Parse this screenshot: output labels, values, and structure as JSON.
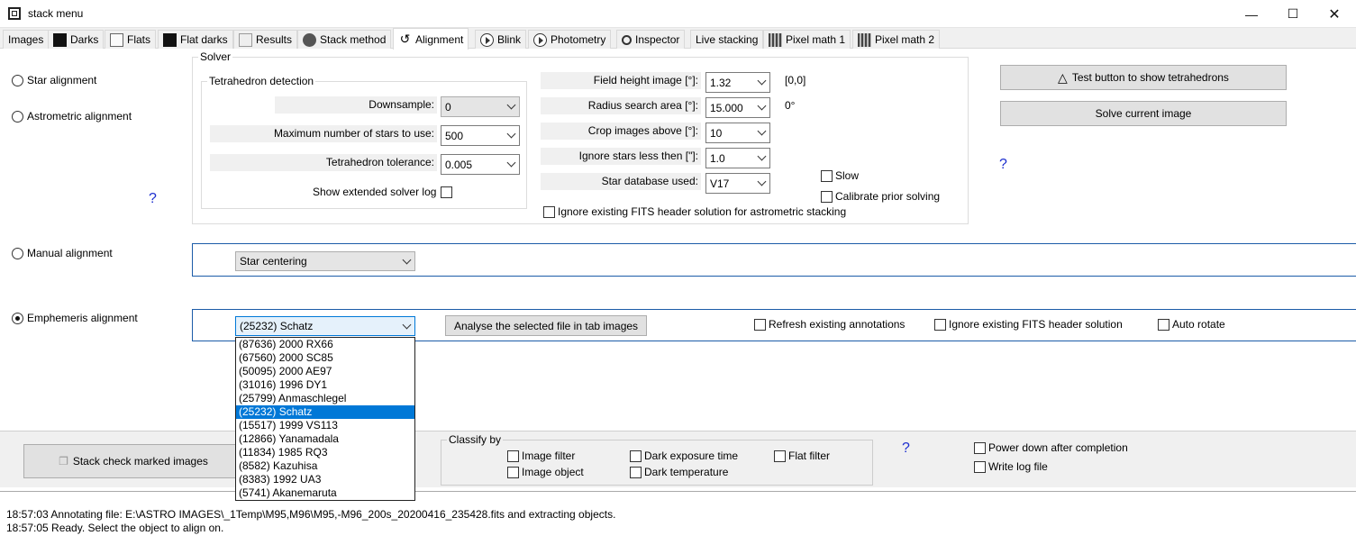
{
  "window": {
    "title": "stack menu",
    "icon": "app-window-icon"
  },
  "tabs": [
    {
      "label": "Images",
      "icon": ""
    },
    {
      "label": "Darks",
      "icon": "dark-frame-icon"
    },
    {
      "label": "Flats",
      "icon": "flat-frame-icon"
    },
    {
      "label": "Flat darks",
      "icon": "dark-frame-icon"
    },
    {
      "label": "Results",
      "icon": "results-icon"
    },
    {
      "label": "Stack method",
      "icon": "gear-icon"
    },
    {
      "label": "Alignment",
      "icon": "alignment-icon"
    },
    {
      "label": "Blink",
      "icon": "play-icon"
    },
    {
      "label": "Photometry",
      "icon": "play-icon"
    },
    {
      "label": "Inspector",
      "icon": "magnifier-icon"
    },
    {
      "label": "Live stacking",
      "icon": ""
    },
    {
      "label": "Pixel math 1",
      "icon": "pixel-math-icon"
    },
    {
      "label": "Pixel math 2",
      "icon": "pixel-math-icon"
    }
  ],
  "active_tab": "Alignment",
  "alignment": {
    "star_alignment": "Star alignment",
    "astrometric_alignment": "Astrometric alignment",
    "manual_alignment": "Manual alignment",
    "ephemeris_alignment": "Emphemeris alignment",
    "selected_method": "Emphemeris alignment",
    "help": "?"
  },
  "solver": {
    "title": "Solver",
    "tetra_group_title": "Tetrahedron detection",
    "downsample_label": "Downsample:",
    "downsample_value": "0",
    "max_stars_label": "Maximum number of stars to use:",
    "max_stars_value": "500",
    "tolerance_label": "Tetrahedron tolerance:",
    "tolerance_value": "0.005",
    "extended_log_label": "Show extended solver log",
    "field_height_label": "Field height image [°]:",
    "field_height_value": "1.32",
    "field_height_info": "[0,0]",
    "radius_label": "Radius search area  [°]:",
    "radius_value": "15.000",
    "radius_info": "0°",
    "crop_label": "Crop images above [°]:",
    "crop_value": "10",
    "ignore_less_label": "Ignore stars less then [\"]:",
    "ignore_less_value": "1.0",
    "database_label": "Star database used:",
    "database_value": "V17",
    "slow_label": "Slow",
    "calibrate_label": "Calibrate prior solving",
    "ignore_fits_label": "Ignore existing FITS header solution for astrometric stacking"
  },
  "buttons": {
    "test_tetra": "Test button to show tetrahedrons",
    "solve_current": "Solve current image",
    "help": "?"
  },
  "manual": {
    "centering_value": "Star centering"
  },
  "ephemeris": {
    "object_value": "(25232) Schatz",
    "analyse_button": "Analyse the selected file in tab images",
    "refresh_label": "Refresh existing annotations",
    "ignore_fits_label": "Ignore existing FITS header solution",
    "auto_rotate_label": "Auto rotate",
    "dropdown_items": [
      "(87636) 2000 RX66",
      "(67560) 2000 SC85",
      "(50095) 2000 AE97",
      "(31016) 1996 DY1",
      "(25799) Anmaschlegel",
      "(25232) Schatz",
      "(15517) 1999 VS113",
      "(12866) Yanamadala",
      "(11834) 1985 RQ3",
      "(8582) Kazuhisa",
      "(8383) 1992 UA3",
      "(5741) Akanemaruta"
    ],
    "selected_item": "(25232) Schatz"
  },
  "bottom": {
    "stack_button": "Stack check marked images",
    "classify_title": "Classify by",
    "image_filter": "Image filter",
    "image_object": "Image object",
    "dark_exposure": "Dark exposure time",
    "dark_temperature": "Dark temperature",
    "flat_filter": "Flat filter",
    "help": "?",
    "power_down": "Power down after completion",
    "write_log": "Write log file"
  },
  "log": [
    "18:57:03  Annotating file: E:\\ASTRO IMAGES\\_1Temp\\M95,M96\\M95,-M96_200s_20200416_235428.fits and extracting objects.",
    "18:57:05  Ready. Select the object to align on."
  ]
}
